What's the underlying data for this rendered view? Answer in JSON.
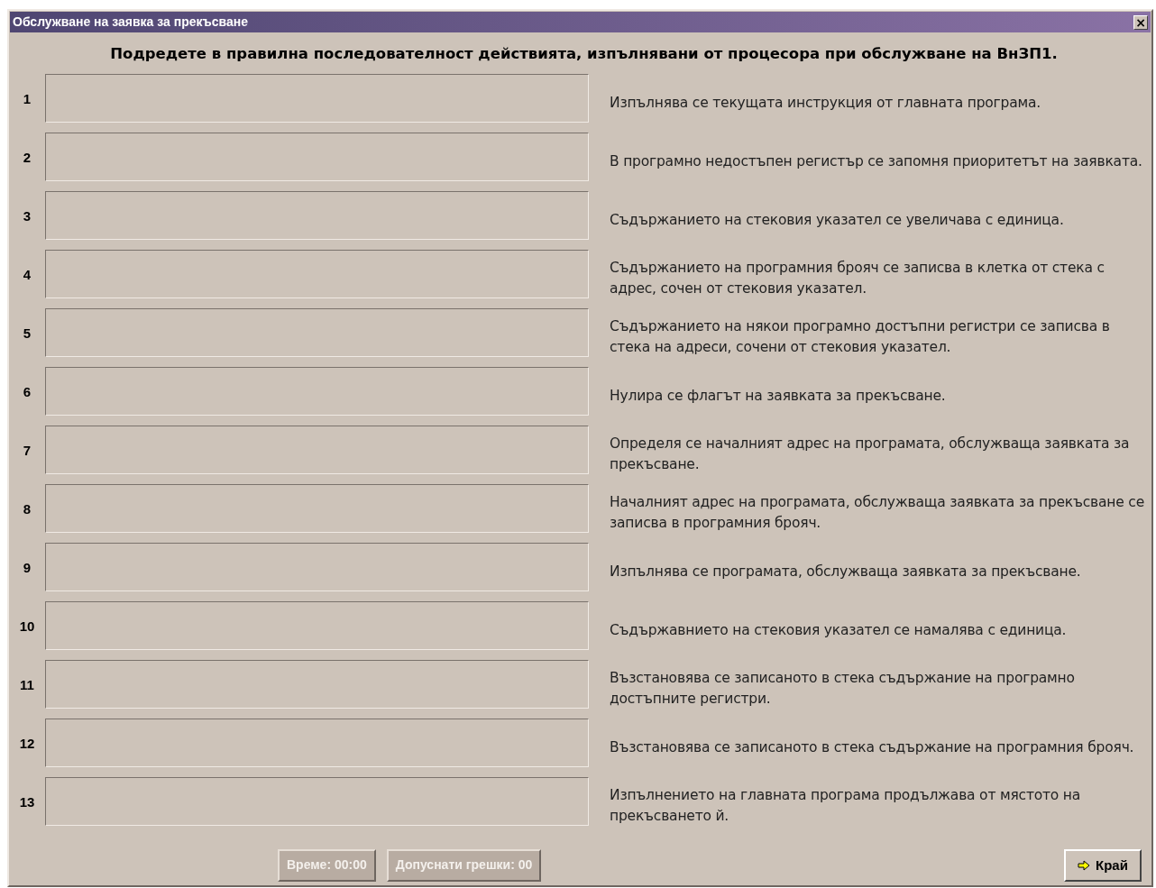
{
  "window": {
    "title": "Обслужване на заявка за прекъсване",
    "close": "×"
  },
  "instruction": "Подредете в правилна последователност действията, изпълнявани от процесора при обслужване на ВнЗП1.",
  "slots": [
    {
      "number": "1"
    },
    {
      "number": "2"
    },
    {
      "number": "3"
    },
    {
      "number": "4"
    },
    {
      "number": "5"
    },
    {
      "number": "6"
    },
    {
      "number": "7"
    },
    {
      "number": "8"
    },
    {
      "number": "9"
    },
    {
      "number": "10"
    },
    {
      "number": "11"
    },
    {
      "number": "12"
    },
    {
      "number": "13"
    }
  ],
  "actions": [
    "Изпълнява се текущата инструкция от главната програма.",
    "В програмно недостъпен регистър се запомня приоритетът на заявката.",
    "Съдържанието на стековия указател се увеличава с единица.",
    "Съдържанието на програмния брояч се записва в клетка от стека с адрес, сочен от стековия указател.",
    "Съдържанието на някои програмно достъпни регистри се записва в стека на адреси, сочени от стековия указател.",
    "Нулира се флагът на заявката за прекъсване.",
    "Определя се началният адрес на програмата, обслужваща заявката за прекъсване.",
    "Началният адрес на програмата, обслужваща заявката за прекъсване се записва в програмния брояч.",
    "Изпълнява се програмата, обслужваща заявката за прекъсване.",
    "Съдържавнието на стековия указател се намалява с единица.",
    "Възстановява се записаното в стека съдържание на програмно достъпните регистри.",
    "Възстановява се записаното в стека съдържание на програмния брояч.",
    "Изпълнението на главната програма продължава от мястото на прекъсването й."
  ],
  "footer": {
    "timer": "Време: 00:00",
    "errors": "Допуснати грешки: 00",
    "finish_button": "Край"
  }
}
